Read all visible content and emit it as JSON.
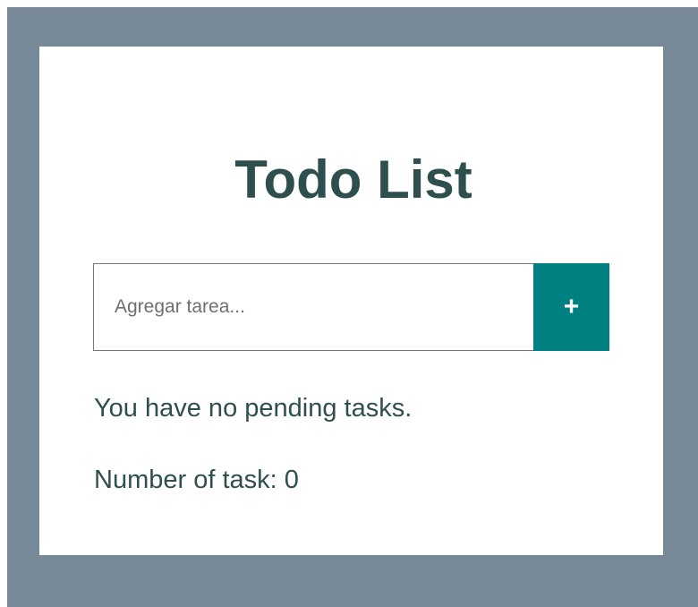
{
  "app": {
    "title": "Todo List"
  },
  "task_form": {
    "input_value": "",
    "input_placeholder": "Agregar tarea...",
    "add_button_label": "+"
  },
  "tasks": {
    "empty_message": "You have no pending tasks.",
    "count_label": "Number of task: ",
    "count": "0"
  },
  "colors": {
    "backdrop": "#778899",
    "card": "#ffffff",
    "title_text": "#2f4f4f",
    "accent_button": "#008080"
  }
}
